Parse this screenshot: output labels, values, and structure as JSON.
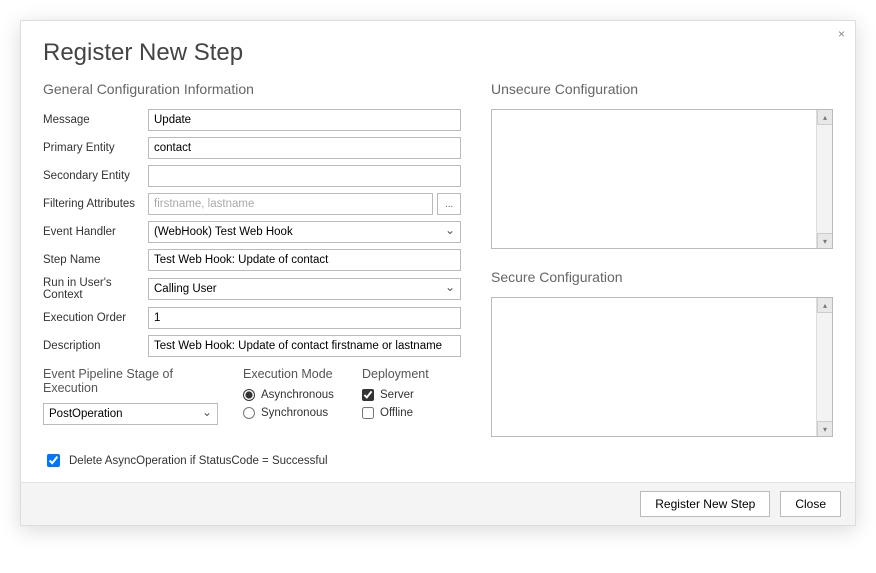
{
  "window": {
    "title": "Register New Step",
    "close_label": "×"
  },
  "general": {
    "heading": "General Configuration Information",
    "message_label": "Message",
    "message_value": "Update",
    "primary_entity_label": "Primary Entity",
    "primary_entity_value": "contact",
    "secondary_entity_label": "Secondary Entity",
    "secondary_entity_value": "",
    "filtering_label": "Filtering Attributes",
    "filtering_placeholder": "firstname, lastname",
    "filtering_value": "",
    "filtering_button": "...",
    "event_handler_label": "Event Handler",
    "event_handler_value": "(WebHook) Test Web Hook",
    "step_name_label": "Step Name",
    "step_name_value": "Test Web Hook: Update of contact",
    "run_context_label": "Run in User's Context",
    "run_context_value": "Calling User",
    "exec_order_label": "Execution Order",
    "exec_order_value": "1",
    "description_label": "Description",
    "description_value": "Test Web Hook: Update of contact firstname or lastname"
  },
  "pipeline": {
    "heading": "Event Pipeline Stage of Execution",
    "stage_value": "PostOperation"
  },
  "exec_mode": {
    "heading": "Execution Mode",
    "async_label": "Asynchronous",
    "sync_label": "Synchronous",
    "selected": "async"
  },
  "deployment": {
    "heading": "Deployment",
    "server_label": "Server",
    "server_checked": true,
    "offline_label": "Offline",
    "offline_checked": false
  },
  "delete_async": {
    "label": "Delete AsyncOperation if StatusCode = Successful",
    "checked": true
  },
  "unsecure": {
    "heading": "Unsecure  Configuration",
    "value": ""
  },
  "secure": {
    "heading": "Secure  Configuration",
    "value": ""
  },
  "footer": {
    "register_label": "Register New Step",
    "close_label": "Close"
  }
}
